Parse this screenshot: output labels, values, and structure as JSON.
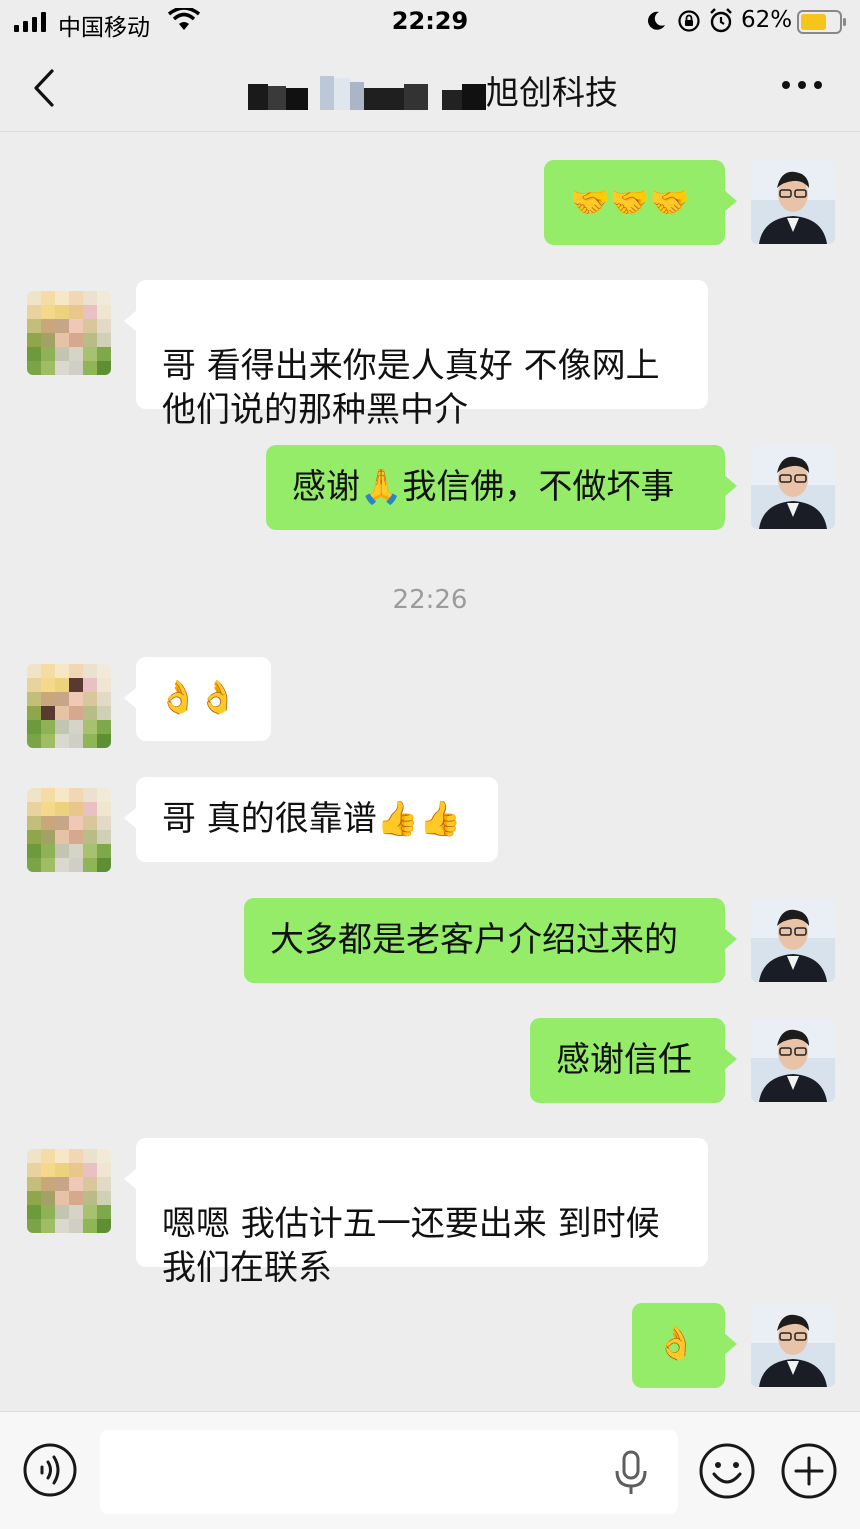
{
  "status_bar": {
    "carrier": "中国移动",
    "time": "22:29",
    "battery": "62%"
  },
  "nav": {
    "title_visible": "旭创科技",
    "back_icon": "chevron-left-icon",
    "more_icon": "more-dots-icon"
  },
  "messages": [
    {
      "side": "out",
      "text": "🤝🤝🤝"
    },
    {
      "side": "in",
      "text": "哥 看得出来你是人真好 不像网上\n他们说的那种黑中介"
    },
    {
      "side": "out",
      "text": "感谢🙏我信佛，不做坏事"
    },
    {
      "side": "time",
      "text": "22:26"
    },
    {
      "side": "in",
      "text": "👌👌"
    },
    {
      "side": "in",
      "text": "哥 真的很靠谱👍👍"
    },
    {
      "side": "out",
      "text": "大多都是老客户介绍过来的"
    },
    {
      "side": "out",
      "text": "感谢信任"
    },
    {
      "side": "in",
      "text": "嗯嗯 我估计五一还要出来 到时候\n我们在联系"
    },
    {
      "side": "out",
      "text": "👌"
    }
  ],
  "input_bar": {
    "value": "",
    "voice_icon": "voice-mode-icon",
    "mic_icon": "microphone-icon",
    "emoji_icon": "emoji-icon",
    "plus_icon": "plus-icon"
  },
  "colors": {
    "background": "#ededed",
    "bubble_out": "#95ec69",
    "bubble_in": "#ffffff",
    "timestamp": "#9b9b9b"
  }
}
